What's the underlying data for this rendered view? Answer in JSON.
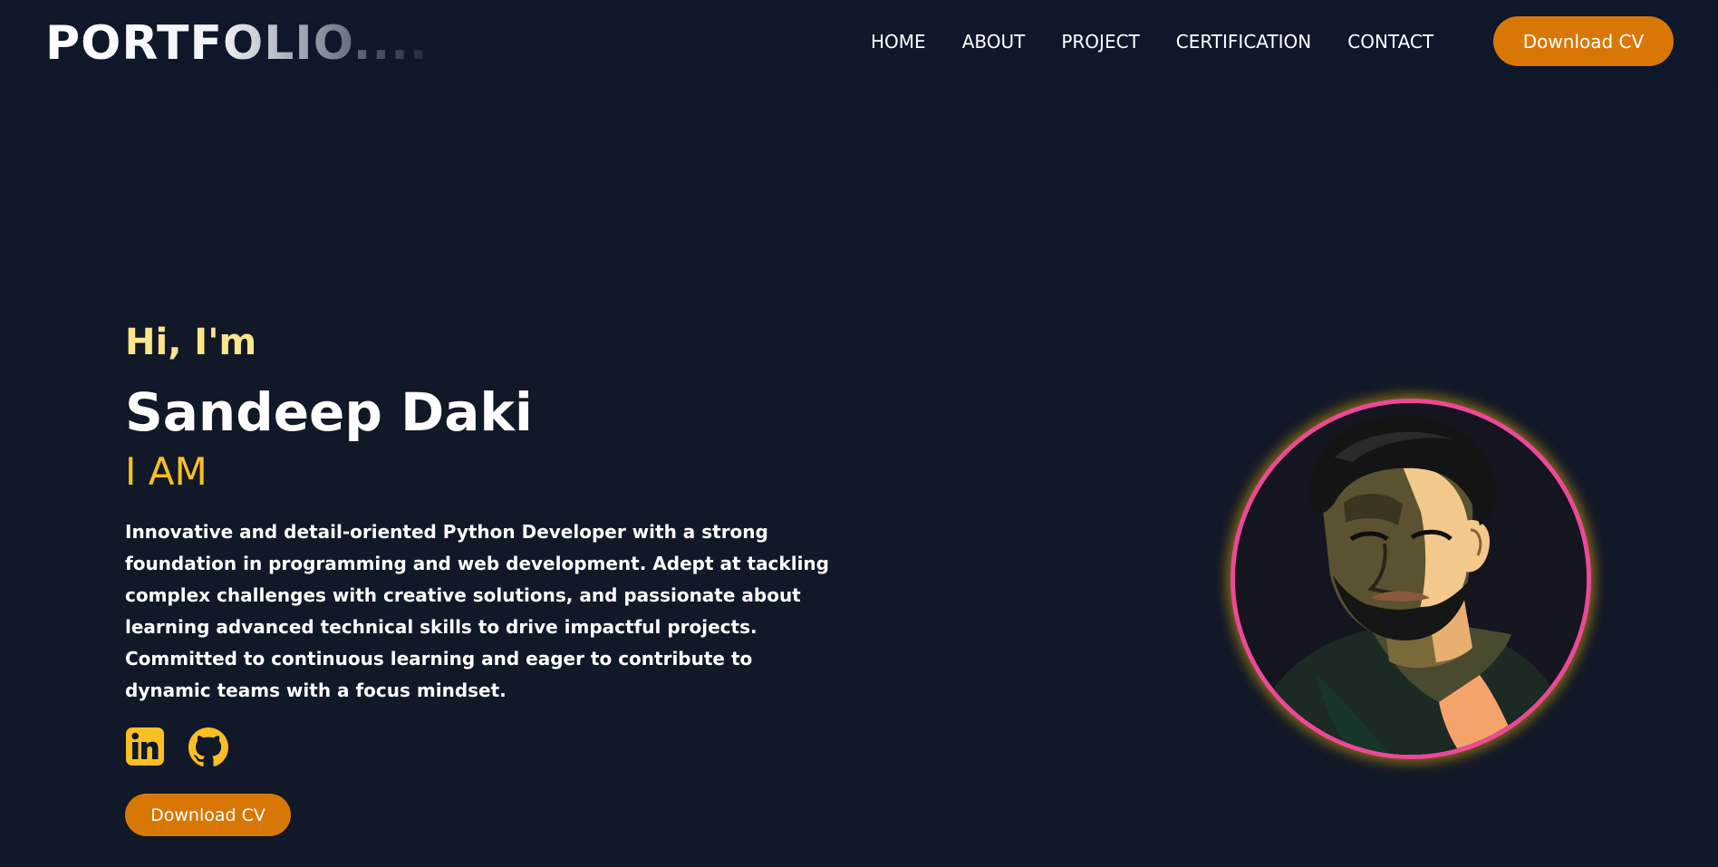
{
  "header": {
    "logo": "PORTFOLIO....",
    "nav": [
      "HOME",
      "ABOUT",
      "PROJECT",
      "CERTIFICATION",
      "CONTACT"
    ],
    "cta_label": "Download CV"
  },
  "hero": {
    "greeting": "Hi, I'm",
    "name": "Sandeep Daki",
    "role_prefix": "I AM",
    "bio": "Innovative and detail-oriented Python Developer with a strong foundation in programming and web development. Adept at tackling complex challenges with creative solutions, and passionate about learning advanced technical skills to drive impactful projects. Committed to continuous learning and eager to contribute to dynamic teams with a focus mindset.",
    "socials": [
      {
        "name": "linkedin-icon"
      },
      {
        "name": "github-icon"
      }
    ],
    "cta_label": "Download CV"
  },
  "portrait": {
    "icon": "profile-portrait-illustration"
  },
  "colors": {
    "background": "#111827",
    "header_background": "#0f172a",
    "accent": "#d97706",
    "greeting": "#fde68a",
    "role": "#fbbf24",
    "portrait_ring": "#ec4899",
    "portrait_glow": "#eab308"
  }
}
